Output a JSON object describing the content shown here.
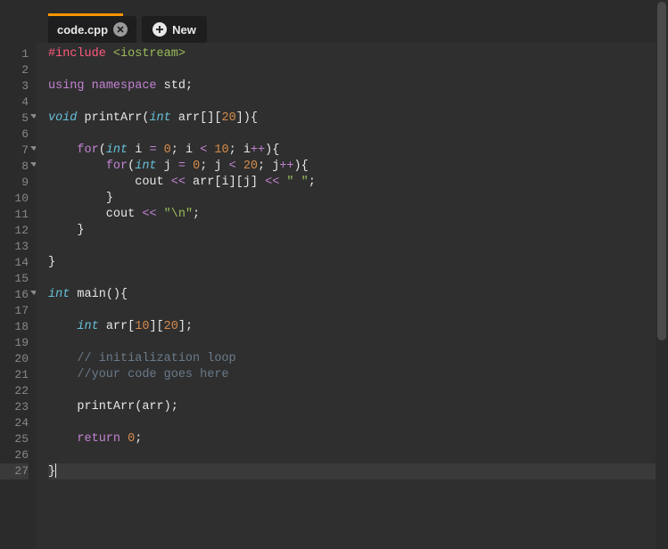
{
  "tabs": {
    "active": {
      "label": "code.cpp"
    },
    "new_label": "New"
  },
  "gutter": {
    "fold_lines": [
      5,
      7,
      8,
      16
    ]
  },
  "code": [
    [
      {
        "cls": "t-preproc",
        "text": "#include"
      },
      {
        "cls": "t-plain",
        "text": " "
      },
      {
        "cls": "t-include",
        "text": "<iostream>"
      }
    ],
    [],
    [
      {
        "cls": "t-keyword",
        "text": "using"
      },
      {
        "cls": "t-plain",
        "text": " "
      },
      {
        "cls": "t-keyword",
        "text": "namespace"
      },
      {
        "cls": "t-plain",
        "text": " "
      },
      {
        "cls": "t-ident",
        "text": "std"
      },
      {
        "cls": "t-punct",
        "text": ";"
      }
    ],
    [],
    [
      {
        "cls": "t-type",
        "text": "void"
      },
      {
        "cls": "t-plain",
        "text": " "
      },
      {
        "cls": "t-func",
        "text": "printArr"
      },
      {
        "cls": "t-paren",
        "text": "("
      },
      {
        "cls": "t-type",
        "text": "int"
      },
      {
        "cls": "t-plain",
        "text": " arr"
      },
      {
        "cls": "t-paren",
        "text": "[]["
      },
      {
        "cls": "t-number",
        "text": "20"
      },
      {
        "cls": "t-paren",
        "text": "])"
      },
      {
        "cls": "t-punct",
        "text": "{"
      }
    ],
    [],
    [
      {
        "cls": "t-plain",
        "text": "    "
      },
      {
        "cls": "t-keyword",
        "text": "for"
      },
      {
        "cls": "t-paren",
        "text": "("
      },
      {
        "cls": "t-type",
        "text": "int"
      },
      {
        "cls": "t-plain",
        "text": " i "
      },
      {
        "cls": "t-op",
        "text": "="
      },
      {
        "cls": "t-plain",
        "text": " "
      },
      {
        "cls": "t-number",
        "text": "0"
      },
      {
        "cls": "t-punct",
        "text": "; "
      },
      {
        "cls": "t-plain",
        "text": "i "
      },
      {
        "cls": "t-op",
        "text": "<"
      },
      {
        "cls": "t-plain",
        "text": " "
      },
      {
        "cls": "t-number",
        "text": "10"
      },
      {
        "cls": "t-punct",
        "text": "; "
      },
      {
        "cls": "t-plain",
        "text": "i"
      },
      {
        "cls": "t-op",
        "text": "++"
      },
      {
        "cls": "t-paren",
        "text": ")"
      },
      {
        "cls": "t-punct",
        "text": "{"
      }
    ],
    [
      {
        "cls": "t-plain",
        "text": "        "
      },
      {
        "cls": "t-keyword",
        "text": "for"
      },
      {
        "cls": "t-paren",
        "text": "("
      },
      {
        "cls": "t-type",
        "text": "int"
      },
      {
        "cls": "t-plain",
        "text": " j "
      },
      {
        "cls": "t-op",
        "text": "="
      },
      {
        "cls": "t-plain",
        "text": " "
      },
      {
        "cls": "t-number",
        "text": "0"
      },
      {
        "cls": "t-punct",
        "text": "; "
      },
      {
        "cls": "t-plain",
        "text": "j "
      },
      {
        "cls": "t-op",
        "text": "<"
      },
      {
        "cls": "t-plain",
        "text": " "
      },
      {
        "cls": "t-number",
        "text": "20"
      },
      {
        "cls": "t-punct",
        "text": "; "
      },
      {
        "cls": "t-plain",
        "text": "j"
      },
      {
        "cls": "t-op",
        "text": "++"
      },
      {
        "cls": "t-paren",
        "text": ")"
      },
      {
        "cls": "t-punct",
        "text": "{"
      }
    ],
    [
      {
        "cls": "t-plain",
        "text": "            cout "
      },
      {
        "cls": "t-op",
        "text": "<<"
      },
      {
        "cls": "t-plain",
        "text": " arr"
      },
      {
        "cls": "t-paren",
        "text": "["
      },
      {
        "cls": "t-plain",
        "text": "i"
      },
      {
        "cls": "t-paren",
        "text": "]["
      },
      {
        "cls": "t-plain",
        "text": "j"
      },
      {
        "cls": "t-paren",
        "text": "]"
      },
      {
        "cls": "t-plain",
        "text": " "
      },
      {
        "cls": "t-op",
        "text": "<<"
      },
      {
        "cls": "t-plain",
        "text": " "
      },
      {
        "cls": "t-string",
        "text": "\" \""
      },
      {
        "cls": "t-punct",
        "text": ";"
      }
    ],
    [
      {
        "cls": "t-plain",
        "text": "        "
      },
      {
        "cls": "t-punct",
        "text": "}"
      }
    ],
    [
      {
        "cls": "t-plain",
        "text": "        cout "
      },
      {
        "cls": "t-op",
        "text": "<<"
      },
      {
        "cls": "t-plain",
        "text": " "
      },
      {
        "cls": "t-string",
        "text": "\"\\n\""
      },
      {
        "cls": "t-punct",
        "text": ";"
      }
    ],
    [
      {
        "cls": "t-plain",
        "text": "    "
      },
      {
        "cls": "t-punct",
        "text": "}"
      }
    ],
    [],
    [
      {
        "cls": "t-punct",
        "text": "}"
      }
    ],
    [],
    [
      {
        "cls": "t-type",
        "text": "int"
      },
      {
        "cls": "t-plain",
        "text": " "
      },
      {
        "cls": "t-func",
        "text": "main"
      },
      {
        "cls": "t-paren",
        "text": "()"
      },
      {
        "cls": "t-punct",
        "text": "{"
      }
    ],
    [],
    [
      {
        "cls": "t-plain",
        "text": "    "
      },
      {
        "cls": "t-type",
        "text": "int"
      },
      {
        "cls": "t-plain",
        "text": " arr"
      },
      {
        "cls": "t-paren",
        "text": "["
      },
      {
        "cls": "t-number",
        "text": "10"
      },
      {
        "cls": "t-paren",
        "text": "]["
      },
      {
        "cls": "t-number",
        "text": "20"
      },
      {
        "cls": "t-paren",
        "text": "]"
      },
      {
        "cls": "t-punct",
        "text": ";"
      }
    ],
    [],
    [
      {
        "cls": "t-plain",
        "text": "    "
      },
      {
        "cls": "t-comment",
        "text": "// initialization loop"
      }
    ],
    [
      {
        "cls": "t-plain",
        "text": "    "
      },
      {
        "cls": "t-comment",
        "text": "//your code goes here"
      }
    ],
    [],
    [
      {
        "cls": "t-plain",
        "text": "    "
      },
      {
        "cls": "t-func",
        "text": "printArr"
      },
      {
        "cls": "t-paren",
        "text": "("
      },
      {
        "cls": "t-plain",
        "text": "arr"
      },
      {
        "cls": "t-paren",
        "text": ")"
      },
      {
        "cls": "t-punct",
        "text": ";"
      }
    ],
    [],
    [
      {
        "cls": "t-plain",
        "text": "    "
      },
      {
        "cls": "t-keyword",
        "text": "return"
      },
      {
        "cls": "t-plain",
        "text": " "
      },
      {
        "cls": "t-number",
        "text": "0"
      },
      {
        "cls": "t-punct",
        "text": ";"
      }
    ],
    [],
    [
      {
        "cls": "t-punct",
        "text": "}"
      }
    ]
  ],
  "active_line": 27,
  "cursor_after_line": 27
}
